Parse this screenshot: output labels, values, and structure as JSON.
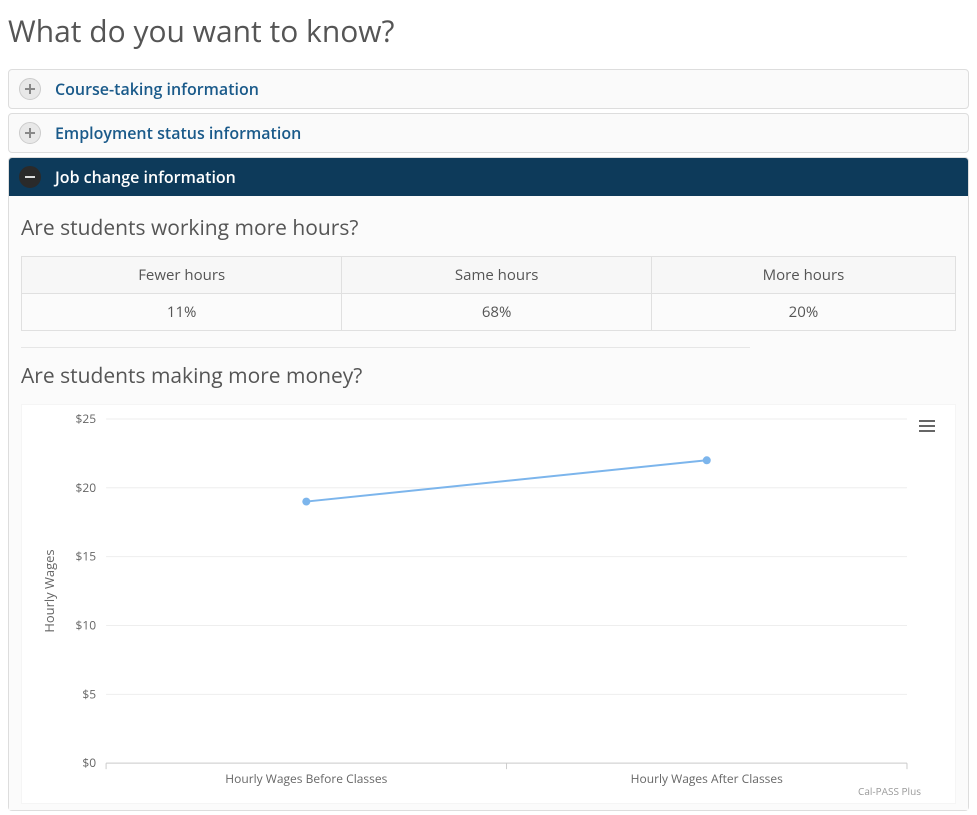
{
  "page_title": "What do you want to know?",
  "accordion": {
    "items": [
      {
        "label": "Course-taking information",
        "state": "collapsed"
      },
      {
        "label": "Employment status information",
        "state": "collapsed"
      },
      {
        "label": "Job change information",
        "state": "expanded"
      }
    ]
  },
  "hours_section": {
    "heading": "Are students working more hours?",
    "columns": [
      "Fewer hours",
      "Same hours",
      "More hours"
    ],
    "values": [
      "11%",
      "68%",
      "20%"
    ]
  },
  "money_section": {
    "heading": "Are students making more money?"
  },
  "chart_data": {
    "type": "line",
    "categories": [
      "Hourly Wages Before Classes",
      "Hourly Wages After Classes"
    ],
    "values": [
      19,
      22
    ],
    "ylabel": "Hourly Wages",
    "xlabel": "",
    "title": "",
    "ylim": [
      0,
      25
    ],
    "yticks": [
      0,
      5,
      10,
      15,
      20,
      25
    ],
    "yprefix": "$",
    "credit": "Cal-PASS Plus"
  }
}
